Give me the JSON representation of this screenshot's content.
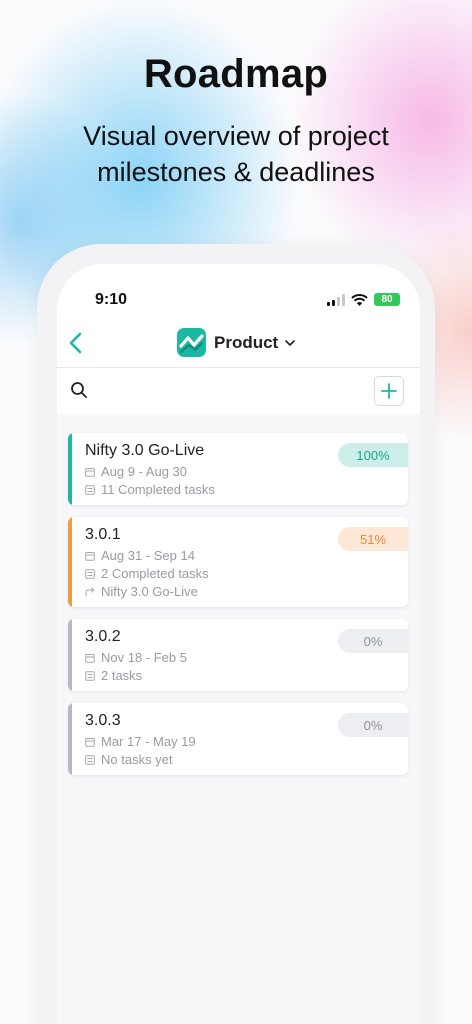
{
  "promo": {
    "headline": "Roadmap",
    "subline": "Visual overview of project milestones & deadlines"
  },
  "status_bar": {
    "time": "9:10",
    "battery": "80"
  },
  "header": {
    "title": "Product",
    "logo_icon": "nifty-logo-icon"
  },
  "colors": {
    "accent_teal": "#1bb8a4",
    "orange": "#f39a42",
    "gray_bar": "#b4b8c6"
  },
  "milestones": [
    {
      "name": "Nifty 3.0 Go-Live",
      "dates": "Aug 9 - Aug 30",
      "tasks": "11 Completed tasks",
      "progress": "100%",
      "color": "#1bb8a4",
      "pill_bg": "#cdeee8",
      "pill_fg": "#1aa491"
    },
    {
      "name": "3.0.1",
      "dates": "Aug 31 - Sep 14",
      "tasks": "2 Completed tasks",
      "depends": "Nifty 3.0 Go-Live",
      "progress": "51%",
      "color": "#f39a42",
      "pill_bg": "#fde7d6",
      "pill_fg": "#ea8a3a"
    },
    {
      "name": "3.0.2",
      "dates": "Nov 18 - Feb 5",
      "tasks": "2 tasks",
      "progress": "0%",
      "color": "#b4b8c6",
      "pill_bg": "#eceef2",
      "pill_fg": "#8e929c"
    },
    {
      "name": "3.0.3",
      "dates": "Mar 17 - May 19",
      "tasks": "No tasks yet",
      "progress": "0%",
      "color": "#b4b8c6",
      "pill_bg": "#eceef2",
      "pill_fg": "#8e929c"
    }
  ]
}
